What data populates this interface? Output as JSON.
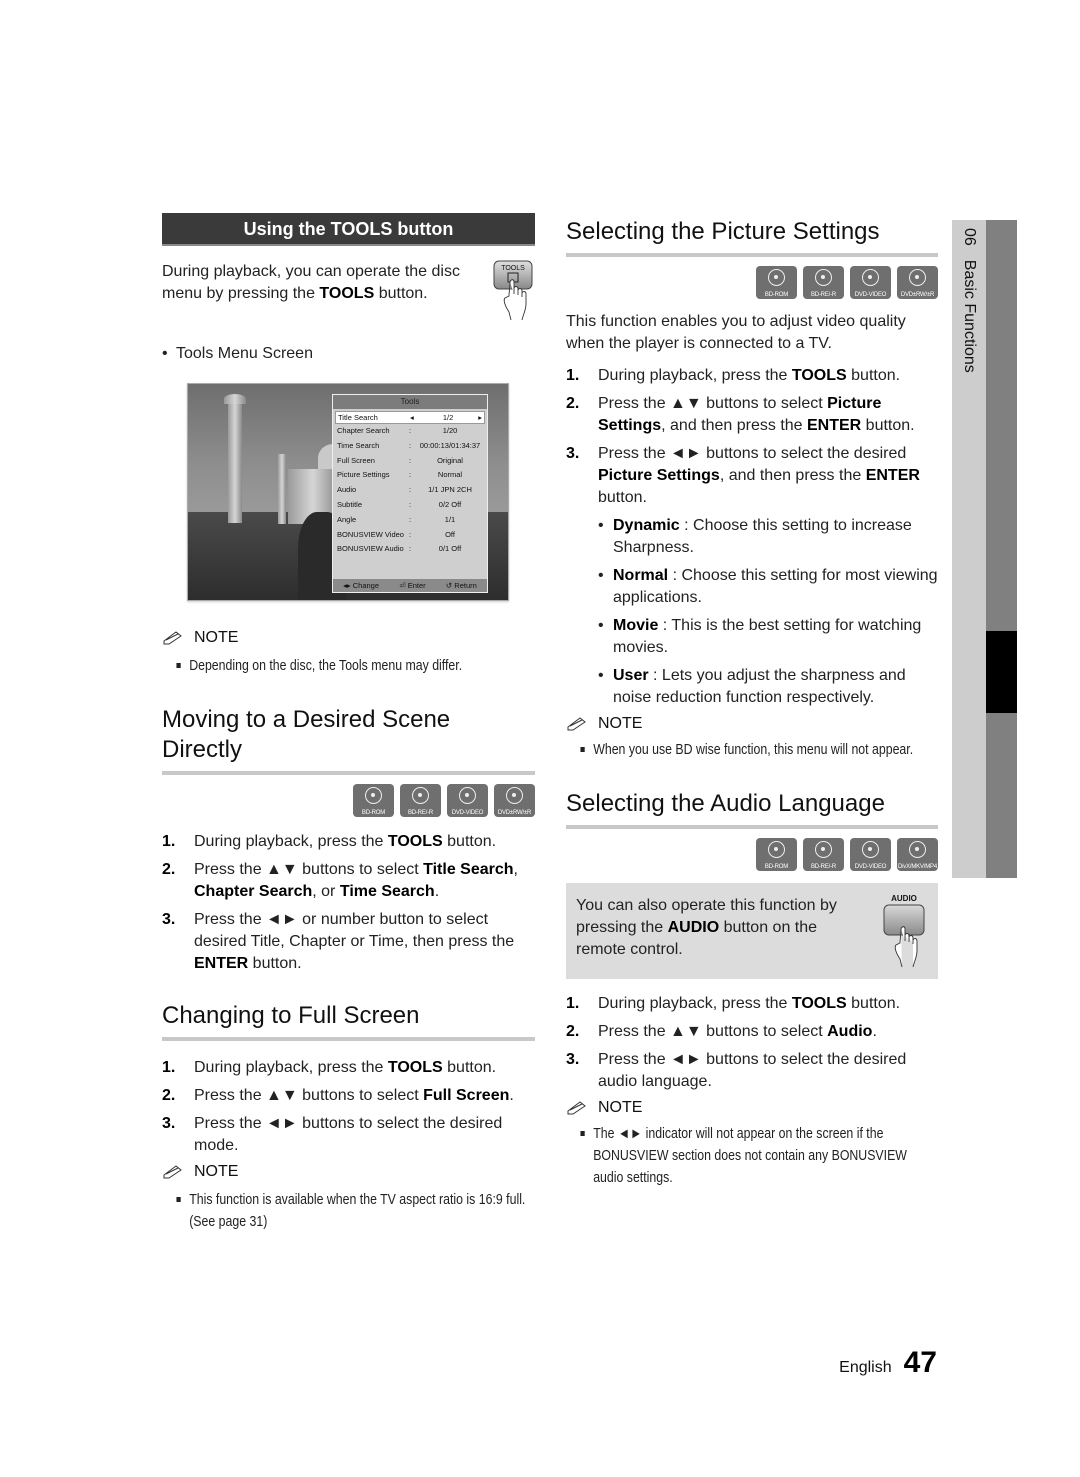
{
  "left": {
    "tools_section": {
      "header": "Using the TOOLS button",
      "intro_pre": "During playback, you can operate the disc menu by pressing the ",
      "intro_bold": "TOOLS",
      "intro_post": " button.",
      "remote_button_label": "TOOLS",
      "bullet": "Tools Menu Screen",
      "tools_menu": {
        "title": "Tools",
        "rows": [
          {
            "label": "Title Search",
            "sep": "◂",
            "value": "1/2",
            "end": "▸"
          },
          {
            "label": "Chapter Search",
            "sep": ":",
            "value": "1/20"
          },
          {
            "label": "Time Search",
            "sep": ":",
            "value": "00:00:13/01:34:37"
          },
          {
            "label": "Full Screen",
            "sep": ":",
            "value": "Original"
          },
          {
            "label": "Picture Settings",
            "sep": ":",
            "value": "Normal"
          },
          {
            "label": "Audio",
            "sep": ":",
            "value": "1/1 JPN 2CH"
          },
          {
            "label": "Subtitle",
            "sep": ":",
            "value": "0/2 Off"
          },
          {
            "label": "Angle",
            "sep": ":",
            "value": "1/1"
          },
          {
            "label": "BONUSVIEW Video",
            "sep": ":",
            "value": "Off"
          },
          {
            "label": "BONUSVIEW Audio",
            "sep": ":",
            "value": "0/1 Off"
          }
        ],
        "footer": [
          "◂▸ Change",
          "⏎ Enter",
          "↺ Return"
        ]
      },
      "note_label": "NOTE",
      "note": "Depending on the disc, the Tools menu may differ."
    },
    "scene_section": {
      "title": "Moving to a Desired Scene Directly",
      "discs": [
        "BD-ROM",
        "BD-RE/-R",
        "DVD-VIDEO",
        "DVD±RW/±R"
      ],
      "steps": [
        {
          "num": "1.",
          "parts": [
            {
              "t": "During playback, press the "
            },
            {
              "b": "TOOLS"
            },
            {
              "t": " button."
            }
          ]
        },
        {
          "num": "2.",
          "parts": [
            {
              "t": "Press the ▲▼ buttons to select "
            },
            {
              "b": "Title Search"
            },
            {
              "t": ", "
            },
            {
              "b": "Chapter Search"
            },
            {
              "t": ", or "
            },
            {
              "b": "Time Search"
            },
            {
              "t": "."
            }
          ]
        },
        {
          "num": "3.",
          "parts": [
            {
              "t": "Press the ◄► or number button to select desired Title, Chapter or Time, then press the "
            },
            {
              "b": "ENTER"
            },
            {
              "t": " button."
            }
          ]
        }
      ]
    },
    "fullscreen_section": {
      "title": "Changing to Full Screen",
      "steps": [
        {
          "num": "1.",
          "parts": [
            {
              "t": "During playback, press the "
            },
            {
              "b": "TOOLS"
            },
            {
              "t": " button."
            }
          ]
        },
        {
          "num": "2.",
          "parts": [
            {
              "t": "Press the ▲▼ buttons to select "
            },
            {
              "b": "Full Screen"
            },
            {
              "t": "."
            }
          ]
        },
        {
          "num": "3.",
          "parts": [
            {
              "t": "Press the ◄► buttons to select the desired mode."
            }
          ]
        }
      ],
      "note_label": "NOTE",
      "note": "This function is available when the TV aspect ratio is 16:9 full. (See page 31)"
    }
  },
  "right": {
    "picture_section": {
      "title": "Selecting the Picture Settings",
      "discs": [
        "BD-ROM",
        "BD-RE/-R",
        "DVD-VIDEO",
        "DVD±RW/±R"
      ],
      "intro": "This function enables you to adjust video quality when the player is connected to a TV.",
      "steps": [
        {
          "num": "1.",
          "parts": [
            {
              "t": "During playback, press the "
            },
            {
              "b": "TOOLS"
            },
            {
              "t": " button."
            }
          ]
        },
        {
          "num": "2.",
          "parts": [
            {
              "t": "Press the ▲▼ buttons to select "
            },
            {
              "b": "Picture Settings"
            },
            {
              "t": ", and then press the "
            },
            {
              "b": "ENTER"
            },
            {
              "t": " button."
            }
          ]
        },
        {
          "num": "3.",
          "parts": [
            {
              "t": "Press the ◄► buttons to select the desired "
            },
            {
              "b": "Picture Settings"
            },
            {
              "t": ", and then press the "
            },
            {
              "b": "ENTER"
            },
            {
              "t": " button."
            }
          ]
        }
      ],
      "options": [
        {
          "name": "Dynamic",
          "desc": " : Choose this setting to increase Sharpness."
        },
        {
          "name": "Normal",
          "desc": " : Choose this setting for most viewing applications."
        },
        {
          "name": "Movie",
          "desc": " : This is the best setting for watching movies."
        },
        {
          "name": "User",
          "desc": " : Lets you adjust the sharpness and noise reduction function respectively."
        }
      ],
      "note_label": "NOTE",
      "note": "When you use BD wise function, this menu will not appear."
    },
    "audio_section": {
      "title": "Selecting the Audio Language",
      "discs": [
        "BD-ROM",
        "BD-RE/-R",
        "DVD-VIDEO",
        "DivX/MKV/MP4"
      ],
      "box_pre": "You can also operate this function by pressing the ",
      "box_bold": "AUDIO",
      "box_post": " button on the remote control.",
      "remote_button_label": "AUDIO",
      "steps": [
        {
          "num": "1.",
          "parts": [
            {
              "t": "During playback, press the "
            },
            {
              "b": "TOOLS"
            },
            {
              "t": " button."
            }
          ]
        },
        {
          "num": "2.",
          "parts": [
            {
              "t": "Press the ▲▼ buttons to select "
            },
            {
              "b": "Audio"
            },
            {
              "t": "."
            }
          ]
        },
        {
          "num": "3.",
          "parts": [
            {
              "t": "Press the ◄► buttons to select the desired audio language."
            }
          ]
        }
      ],
      "note_label": "NOTE",
      "note": "The ◄► indicator will not appear on the screen if the BONUSVIEW section does not contain any BONUSVIEW audio settings."
    }
  },
  "side_tab": {
    "chapter_num": "06",
    "chapter_name": "Basic Functions"
  },
  "footer": {
    "language": "English",
    "page_number": "47"
  }
}
